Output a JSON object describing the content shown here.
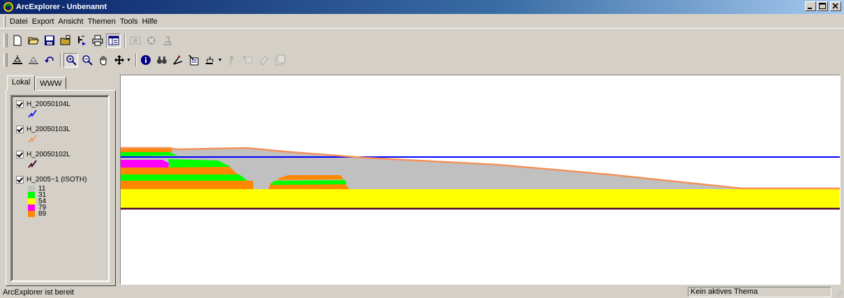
{
  "window": {
    "title": "ArcExplorer - Unbenannt",
    "minimize_label": "_",
    "maximize_label": "□",
    "close_label": "×"
  },
  "menu": [
    {
      "label": "Datei"
    },
    {
      "label": "Export"
    },
    {
      "label": "Ansicht"
    },
    {
      "label": "Themen"
    },
    {
      "label": "Tools"
    },
    {
      "label": "Hilfe"
    }
  ],
  "toolbar1": [
    "new-icon",
    "open-icon",
    "save-icon",
    "open-folder-icon",
    "add-theme-icon",
    "print-icon",
    "table-icon",
    "map-capture-icon",
    "delete-icon",
    "properties-icon"
  ],
  "toolbar2": [
    "layer-icon",
    "layer-up-icon",
    "undo-icon",
    "zoom-in-icon",
    "zoom-out-icon",
    "pan-icon",
    "move-icon",
    "identify-icon",
    "find-icon",
    "measure-icon",
    "query-icon",
    "select-icon",
    "pin-icon",
    "label-icon",
    "eraser-icon",
    "settings-icon"
  ],
  "tabs": [
    {
      "label": "Lokal",
      "active": true
    },
    {
      "label": "WWW",
      "active": false
    }
  ],
  "legend": {
    "layers": [
      {
        "name": "H_20050104L",
        "checked": true,
        "color": "#0000ff"
      },
      {
        "name": "H_20050103L",
        "checked": true,
        "color": "#f4915a"
      },
      {
        "name": "H_20050102L",
        "checked": true,
        "color": "#4a0a2a"
      },
      {
        "name": "H_2005~1 (ISOTH)",
        "checked": true
      }
    ],
    "classes": [
      {
        "label": "11",
        "color": "#c0c0c0"
      },
      {
        "label": "31",
        "color": "#00ff00"
      },
      {
        "label": "54",
        "color": "#ffff00"
      },
      {
        "label": "79",
        "color": "#ff00ff"
      },
      {
        "label": "89",
        "color": "#ff8800"
      }
    ]
  },
  "status": {
    "left": "ArcExplorer ist bereit",
    "right": "Kein aktives Thema"
  }
}
